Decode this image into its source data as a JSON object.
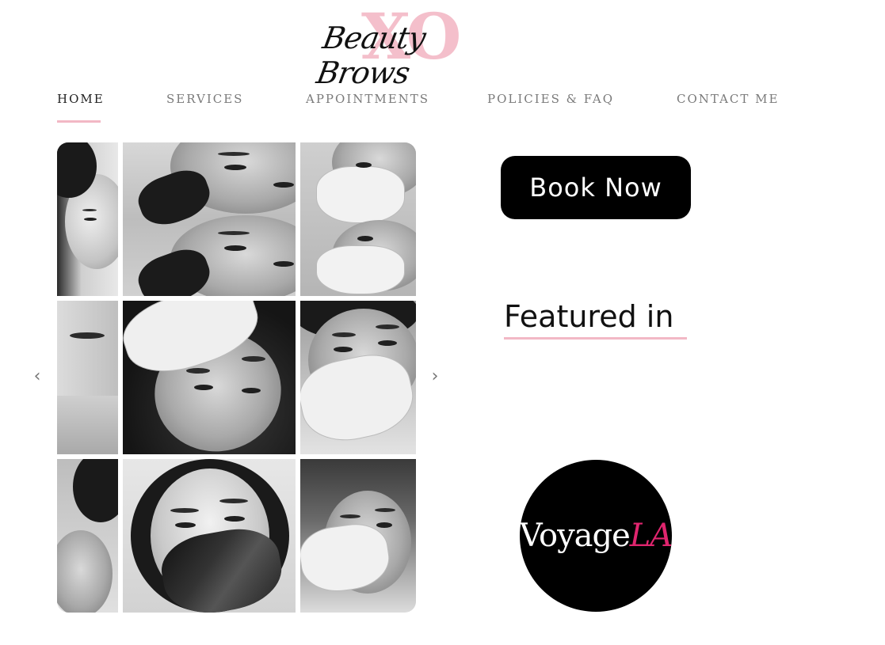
{
  "logo": {
    "monogram": "XO",
    "script": "Beauty Brows"
  },
  "nav": {
    "items": [
      {
        "label": "HOME",
        "active": true
      },
      {
        "label": "SERVICES",
        "active": false
      },
      {
        "label": "APPOINTMENTS",
        "active": false
      },
      {
        "label": "POLICIES & FAQ",
        "active": false
      },
      {
        "label": "CONTACT ME",
        "active": false
      }
    ]
  },
  "gallery": {
    "prev_icon": "chevron-left-icon",
    "next_icon": "chevron-right-icon",
    "prev_glyph": "‹",
    "next_glyph": "›"
  },
  "book_button": {
    "label": "Book Now"
  },
  "featured": {
    "heading": "Featured in",
    "logo_part1": "Voyage",
    "logo_part2": "LA"
  },
  "colors": {
    "accent_pink": "#f2b8c5",
    "voyage_pink": "#e0256e",
    "button_bg": "#000000"
  }
}
